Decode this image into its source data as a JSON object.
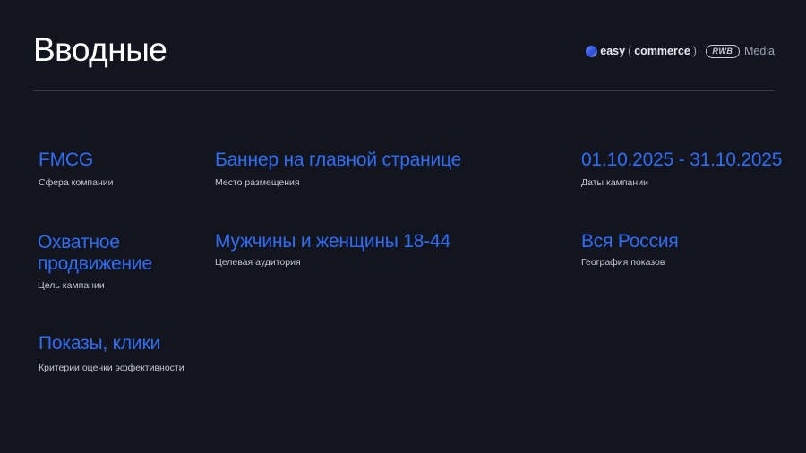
{
  "title": "Вводные",
  "logos": {
    "easy_prefix": "easy",
    "paren_open": "(",
    "commerce": "commerce",
    "paren_close": ")",
    "rwb_badge": "RWB",
    "media": "Media"
  },
  "items": [
    {
      "value": "FMCG",
      "label": "Сфера компании"
    },
    {
      "value": "Баннер на главной странице",
      "label": "Место размещения"
    },
    {
      "value": "01.10.2025 - 31.10.2025",
      "label": "Даты кампании"
    },
    {
      "value_line1": "Охватное",
      "value_line2": "продвижение",
      "label": "Цель кампании"
    },
    {
      "value": "Мужчины и женщины 18-44",
      "label": "Целевая аудитория"
    },
    {
      "value": "Вся Россия",
      "label": "География показов"
    },
    {
      "value": "Показы, клики",
      "label": "Критерии оценки эффективности"
    }
  ],
  "colors": {
    "background": "#13151e",
    "accent": "#2f6df5",
    "title": "#ffffff",
    "label": "#c3c6cf"
  }
}
